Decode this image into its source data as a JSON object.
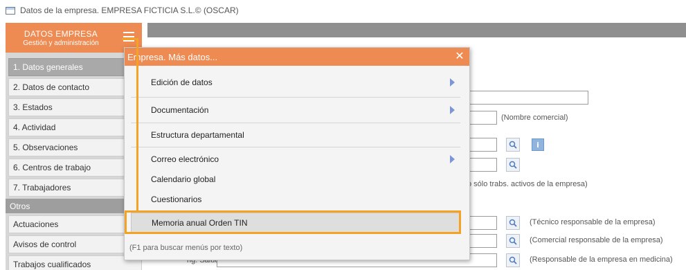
{
  "window": {
    "title": "Datos de la empresa. EMPRESA FICTICIA S.L.© (OSCAR)"
  },
  "sidebar": {
    "header_title": "DATOS EMPRESA",
    "header_subtitle": "Gestión y administración",
    "items": [
      {
        "label": "1. Datos generales",
        "active": true
      },
      {
        "label": "2. Datos de contacto"
      },
      {
        "label": "3. Estados"
      },
      {
        "label": "4. Actividad"
      },
      {
        "label": "5. Observaciones"
      },
      {
        "label": "6. Centros de trabajo"
      },
      {
        "label": "7. Trabajadores"
      }
    ],
    "section_label": "Otros",
    "other_items": [
      {
        "label": "Actuaciones"
      },
      {
        "label": "Avisos de control"
      },
      {
        "label": "Trabajos cualificados"
      }
    ]
  },
  "form": {
    "nombre_comercial_note": "(Nombre comercial)",
    "trabajadores_note": "o sólo trabs. activos de la empresa)",
    "tecnico_note": "(Técnico responsable de la empresa)",
    "comercial_note": "(Comercial responsable de la empresa)",
    "medicina_note": "(Responsable de la empresa en medicina)",
    "partial_label": "rig. Salud."
  },
  "popup": {
    "title": "Empresa. Más datos...",
    "items": [
      {
        "label": "Edición de datos",
        "submenu": true
      },
      {
        "label": "Documentación",
        "submenu": true
      },
      {
        "label": "Estructura departamental",
        "submenu": false
      },
      {
        "label": "Correo electrónico",
        "submenu": true
      },
      {
        "label": "Calendario global",
        "submenu": false
      },
      {
        "label": "Cuestionarios",
        "submenu": false
      },
      {
        "label": "Memoria anual Orden TIN",
        "submenu": false,
        "highlighted": true
      }
    ],
    "hint": "(F1 para buscar menús por texto)"
  },
  "colors": {
    "accent": "#ee8b52",
    "annotation": "#f4a223",
    "submenu_arrow": "#7b95d6"
  },
  "icons": {
    "hamburger": "menu-icon",
    "close": "close-icon",
    "lookup": "magnifier-icon",
    "info": "info-icon"
  }
}
